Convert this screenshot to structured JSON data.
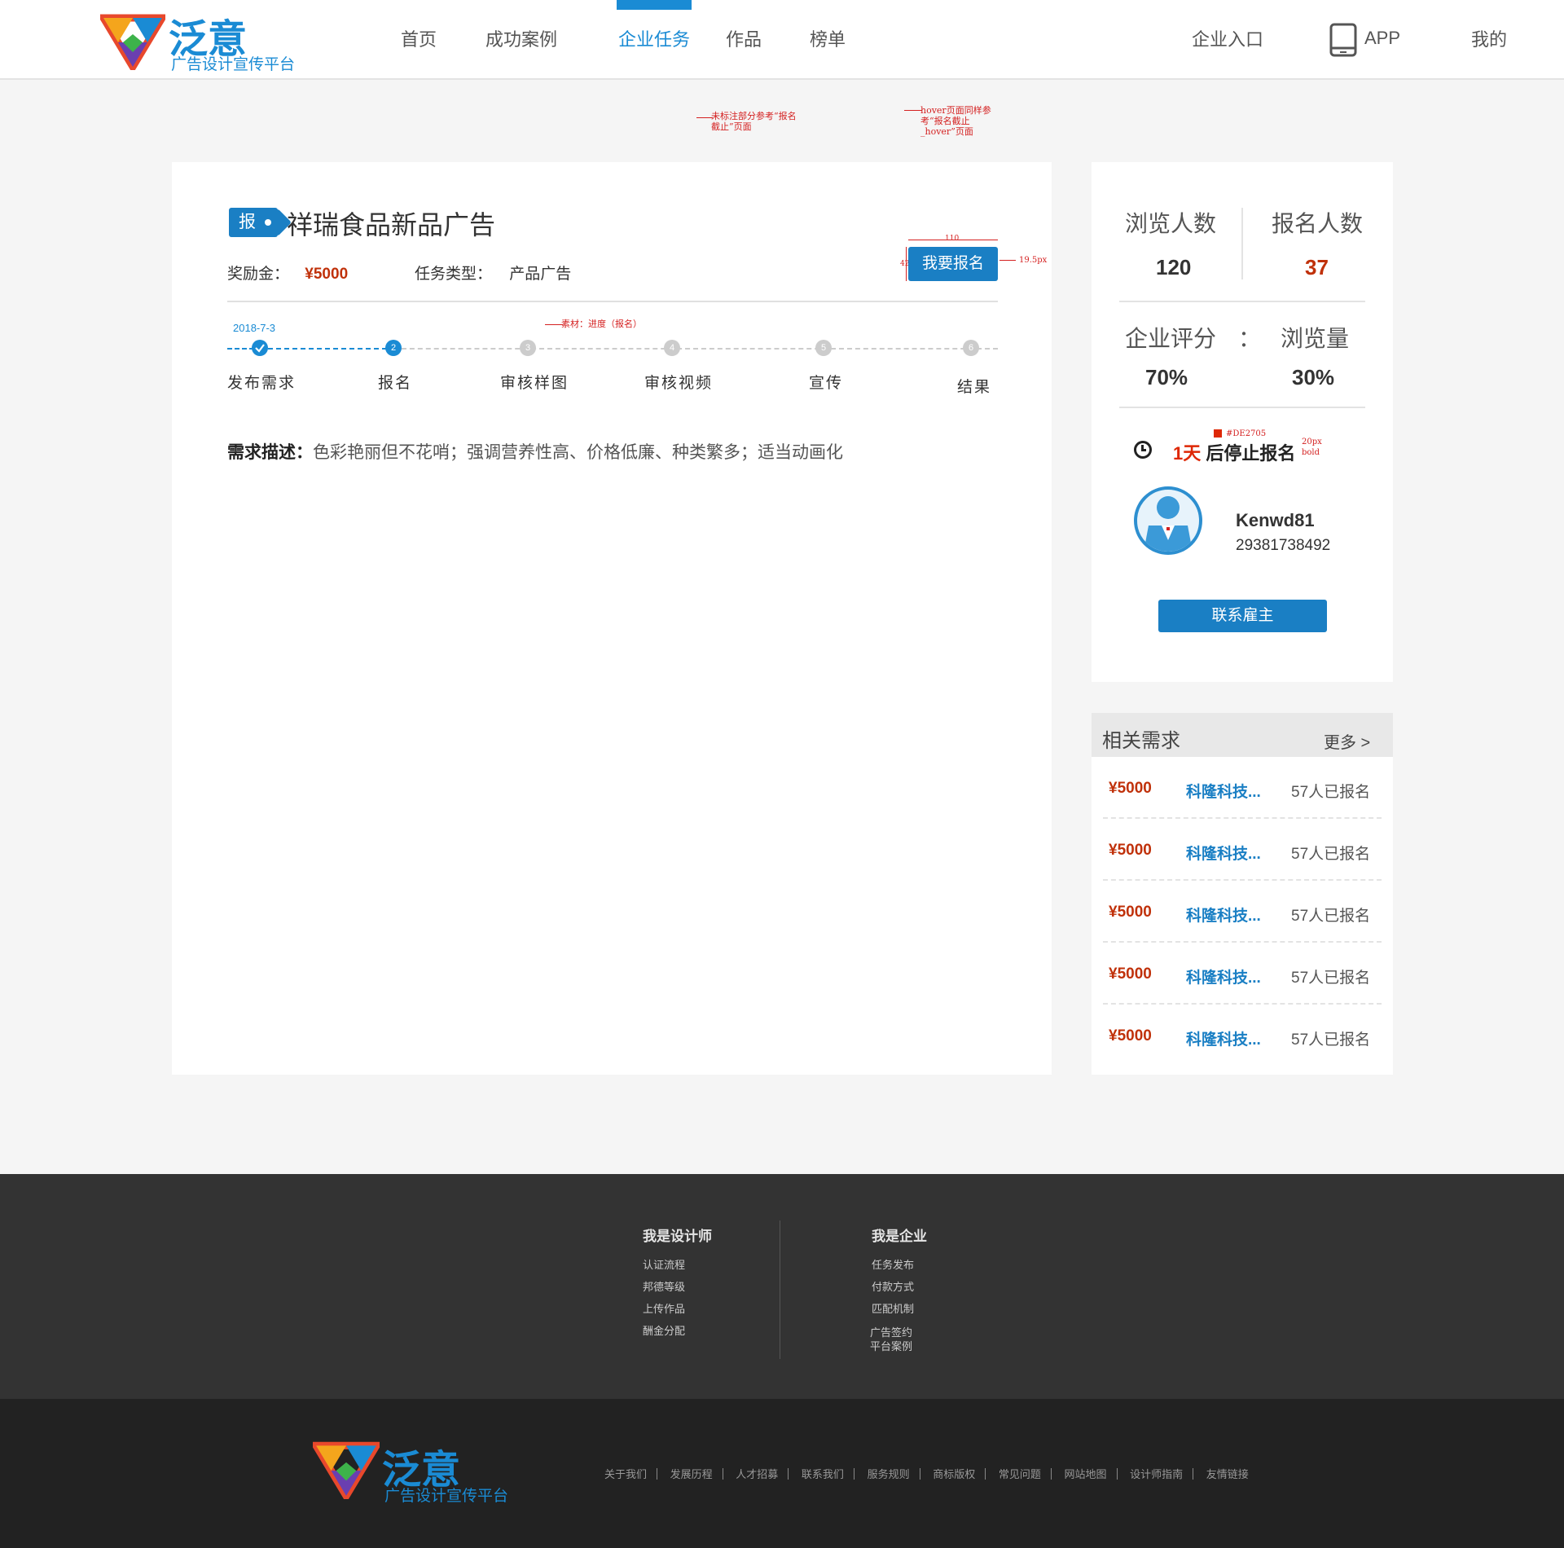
{
  "brand": {
    "name": "泛意",
    "tagline": "广告设计宣传平台"
  },
  "nav": {
    "items": [
      "首页",
      "成功案例",
      "企业任务",
      "作品",
      "榜单"
    ],
    "active_index": 2,
    "enterprise_entry": "企业入口",
    "app_label": "APP",
    "mine": "我的"
  },
  "notes": {
    "n1": "未标注部分参考“报名截止”页面",
    "n2": "hover页面同样参考“报名截止_hover”页面",
    "n3": "素材：进度（报名）",
    "dim_w": "110",
    "dim_h": "42",
    "dim_r": "19.5px",
    "color_note": "#DE2705",
    "font_note": "20px bold"
  },
  "task": {
    "tag": "报",
    "title": "祥瑞食品新品广告",
    "reward_label": "奖励金：",
    "reward_value": "¥5000",
    "type_label": "任务类型：",
    "type_value": "产品广告",
    "signup_button": "我要报名",
    "steps": [
      "发布需求",
      "报名",
      "审核样图",
      "审核视频",
      "宣传",
      "结果"
    ],
    "step_numbers": [
      "",
      "2",
      "3",
      "4",
      "5",
      "6"
    ],
    "step_date": "2018-7-3",
    "current_step": 2,
    "desc_label": "需求描述：",
    "desc_text": "色彩艳丽但不花哨；强调营养性高、价格低廉、种类繁多；适当动画化"
  },
  "stats": {
    "views_label": "浏览人数",
    "views_value": "120",
    "signups_label": "报名人数",
    "signups_value": "37",
    "rating_label": "企业评分",
    "colon": "：",
    "rating_value": "70%",
    "pv_label": "浏览量",
    "pv_value": "30%",
    "countdown_days": "1天",
    "countdown_text": "后停止报名"
  },
  "employer": {
    "name": "Kenwd81",
    "phone": "29381738492",
    "contact_button": "联系雇主"
  },
  "related": {
    "title": "相关需求",
    "more": "更多 >",
    "items": [
      {
        "price": "¥5000",
        "name": "科隆科技...",
        "count": "57人已报名"
      },
      {
        "price": "¥5000",
        "name": "科隆科技...",
        "count": "57人已报名"
      },
      {
        "price": "¥5000",
        "name": "科隆科技...",
        "count": "57人已报名"
      },
      {
        "price": "¥5000",
        "name": "科隆科技...",
        "count": "57人已报名"
      },
      {
        "price": "¥5000",
        "name": "科隆科技...",
        "count": "57人已报名"
      }
    ]
  },
  "footer": {
    "designer_title": "我是设计师",
    "designer_links": [
      "认证流程",
      "邦德等级",
      "上传作品",
      "酬金分配"
    ],
    "enterprise_title": "我是企业",
    "enterprise_links": [
      "任务发布",
      "付款方式",
      "匹配机制",
      "广告签约",
      "平台案例"
    ],
    "bottom_links": [
      "关于我们",
      "发展历程",
      "人才招募",
      "联系我们",
      "服务规则",
      "商标版权",
      "常见问题",
      "网站地图",
      "设计师指南",
      "友情链接"
    ]
  },
  "colors": {
    "accent": "#1a8bd4",
    "button": "#1a7fc4",
    "price_red": "#c0310a",
    "countdown_red": "#de2705",
    "footer_top": "#333333",
    "footer_bottom": "#222222"
  },
  "icons": {
    "app": "tablet-icon",
    "clock": "clock-icon",
    "avatar": "user-avatar-icon",
    "tag": "price-tag-icon"
  }
}
